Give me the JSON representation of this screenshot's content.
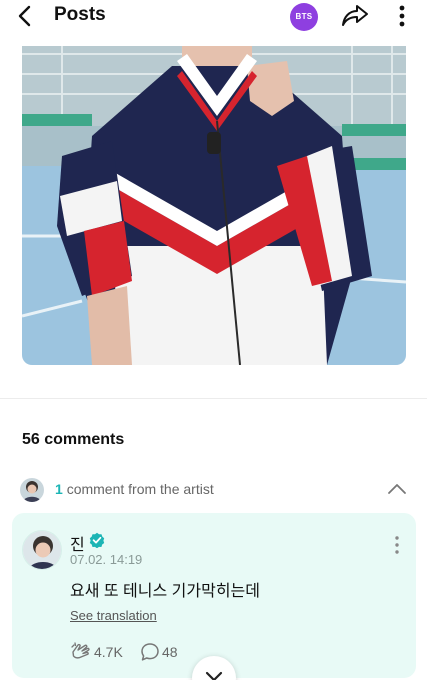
{
  "header": {
    "title": "Posts",
    "community_badge": "BTS",
    "badge_color": "#8e3fe0"
  },
  "post": {
    "image_alt": "tennis-court-photo-jacket"
  },
  "comments": {
    "count_label": "56 comments",
    "artist_count": "1",
    "artist_label": "comment from the artist"
  },
  "artist_comment": {
    "author": "진",
    "timestamp": "07.02. 14:19",
    "text": "요새 또 테니스 기가막히는데",
    "translate_label": "See translation",
    "likes": "4.7K",
    "replies": "48",
    "card_color": "#e8faf6",
    "accent": "#1cb5b5"
  }
}
